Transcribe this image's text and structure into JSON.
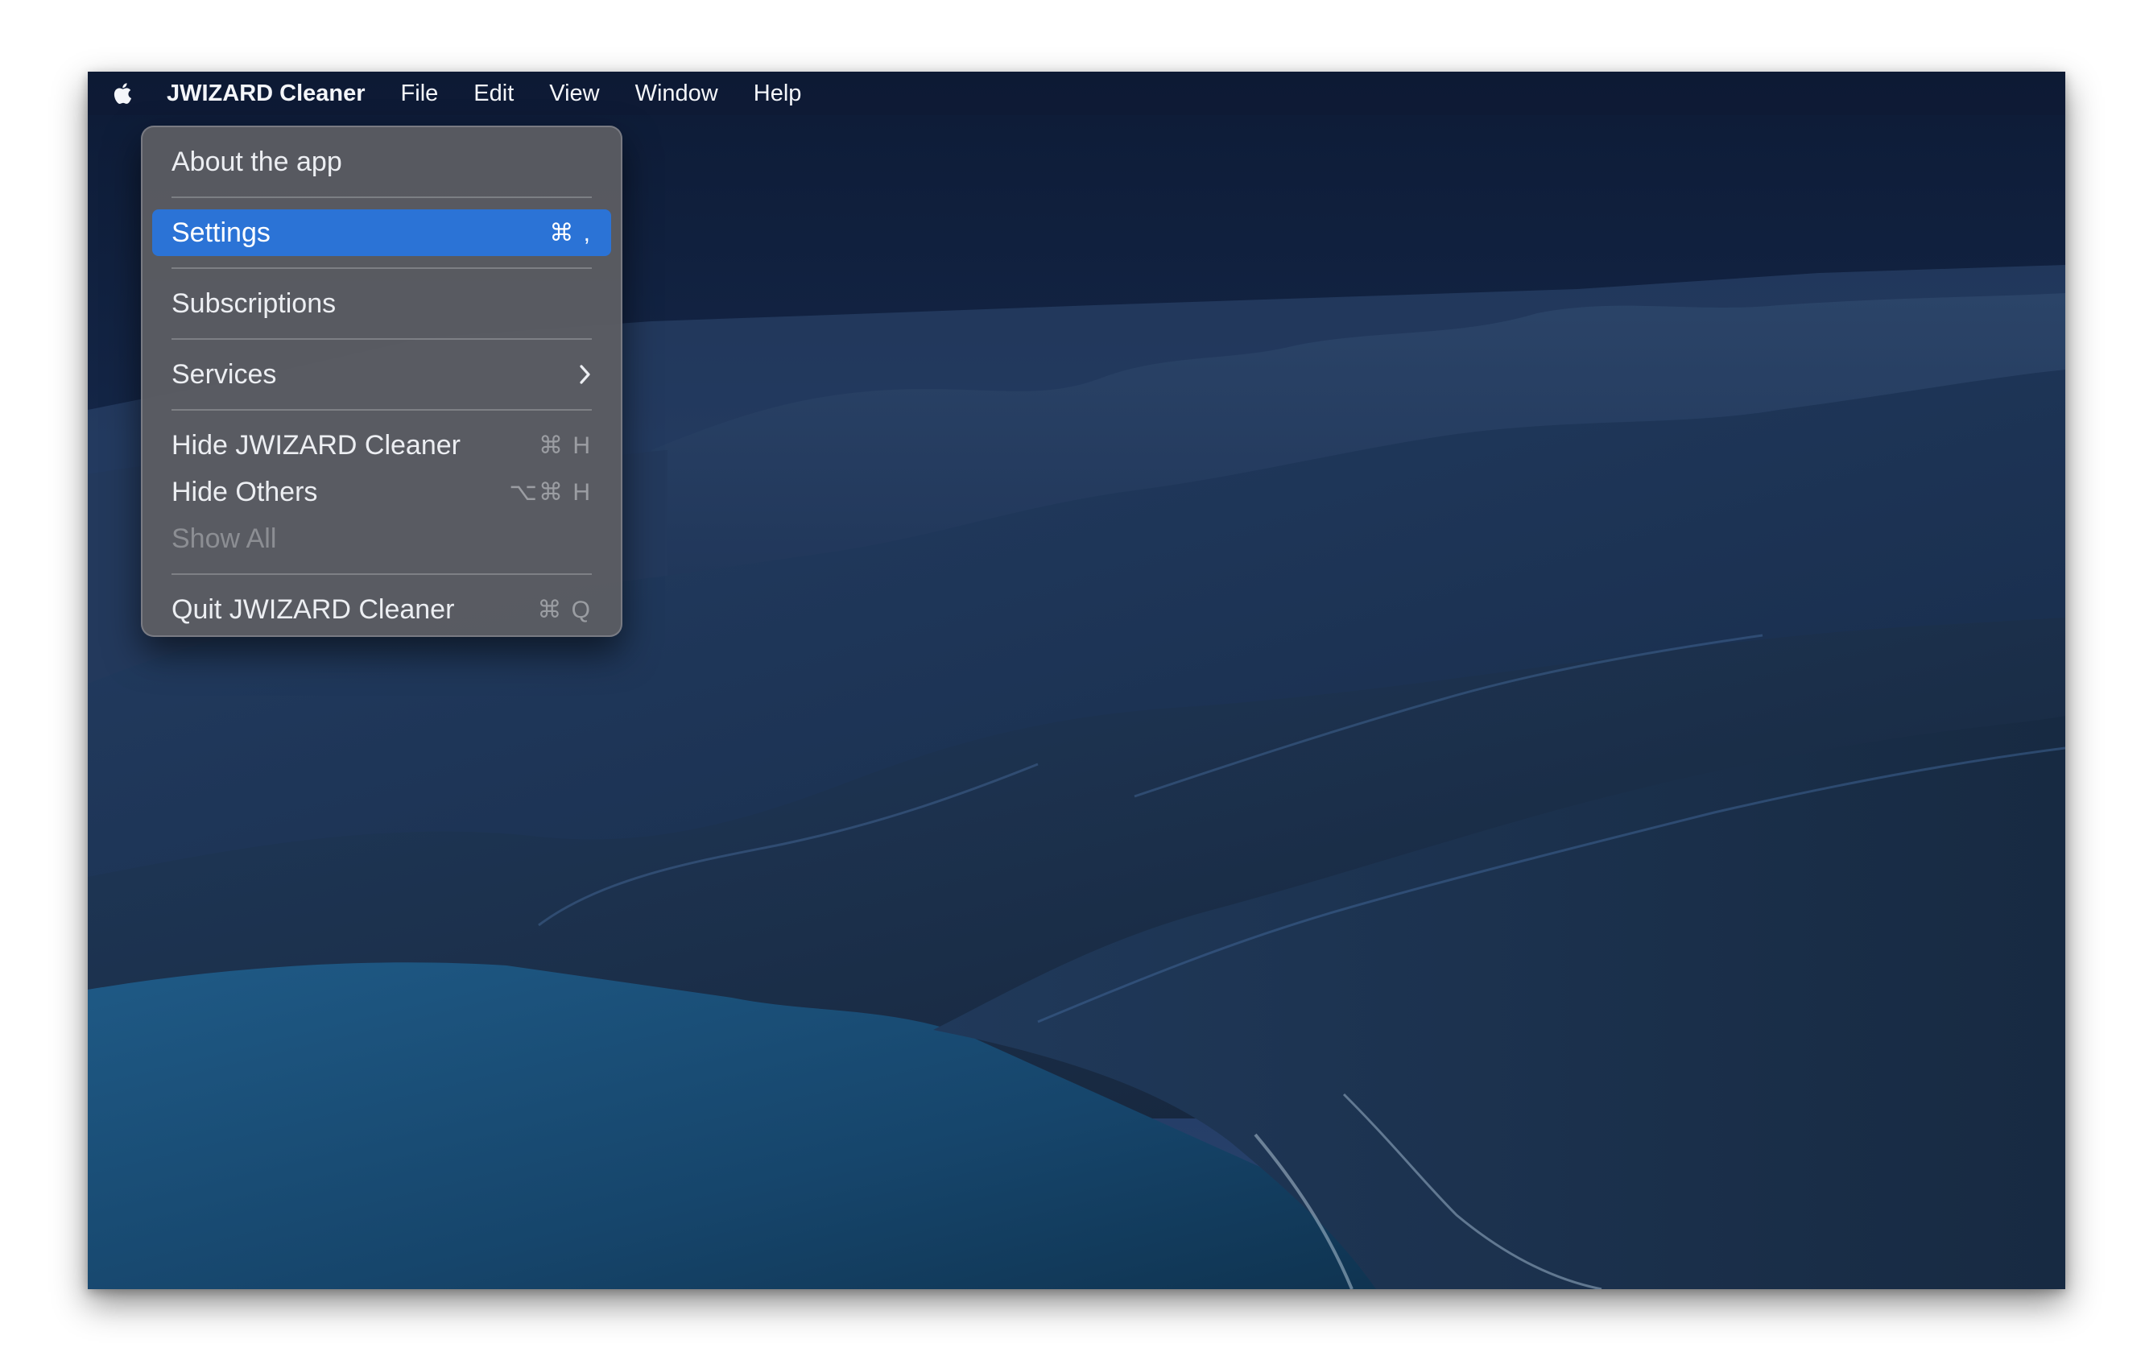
{
  "menubar": {
    "apple_icon": "apple-icon",
    "app_name": "JWIZARD Cleaner",
    "items": [
      "File",
      "Edit",
      "View",
      "Window",
      "Help"
    ]
  },
  "app_menu": {
    "about": "About the app",
    "settings": {
      "label": "Settings",
      "shortcut": "⌘ ,"
    },
    "subscriptions": "Subscriptions",
    "services": {
      "label": "Services",
      "icon": "chevron-right-icon"
    },
    "hide_app": {
      "label": "Hide JWIZARD Cleaner",
      "shortcut": "⌘ H"
    },
    "hide_others": {
      "label": "Hide Others",
      "shortcut": "⌥⌘ H"
    },
    "show_all": "Show All",
    "quit": {
      "label": "Quit JWIZARD Cleaner",
      "shortcut": "⌘ Q"
    }
  },
  "colors": {
    "highlight": "#2b73d6",
    "menu_bg": "#5c5e63"
  }
}
